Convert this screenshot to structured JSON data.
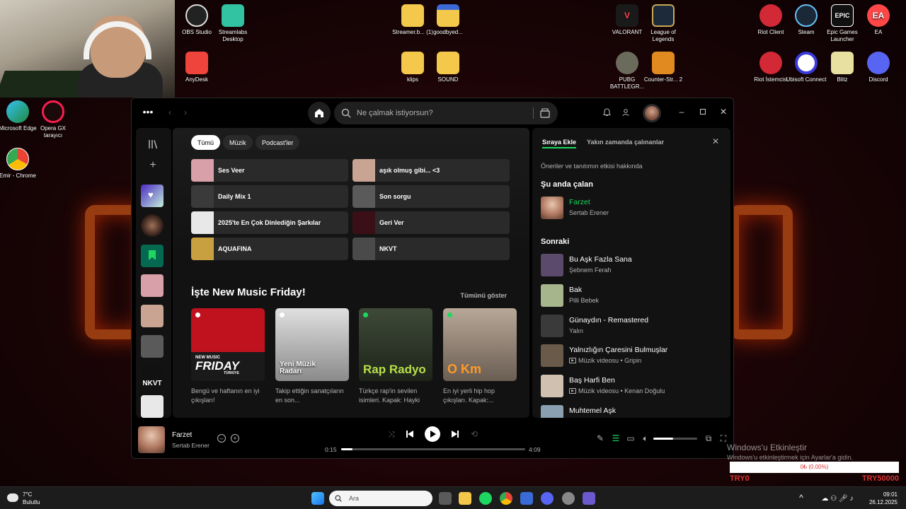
{
  "desktop": {
    "icons": [
      {
        "label": "OBS Studio"
      },
      {
        "label": "Streamlabs Desktop"
      },
      {
        "label": "AnyDesk"
      },
      {
        "label": "Streamer.b... (1)"
      },
      {
        "label": "goodbyed..."
      },
      {
        "label": "klips"
      },
      {
        "label": "SOUND"
      },
      {
        "label": "VALORANT"
      },
      {
        "label": "League of Legends"
      },
      {
        "label": "PUBG BATTLEGR..."
      },
      {
        "label": "Counter-Str... 2"
      },
      {
        "label": "Riot Client"
      },
      {
        "label": "Steam"
      },
      {
        "label": "Epic Games Launcher"
      },
      {
        "label": "EA"
      },
      {
        "label": "Riot İstemcisi"
      },
      {
        "label": "Ubisoft Connect"
      },
      {
        "label": "Blitz"
      },
      {
        "label": "Discord"
      },
      {
        "label": "Microsoft Edge"
      },
      {
        "label": "Opera GX tarayıcı"
      },
      {
        "label": "Emir - Chrome"
      }
    ],
    "epic_logo_text": "EPIC",
    "ea_logo_text": "EA"
  },
  "spotify": {
    "search_placeholder": "Ne çalmak istiyorsun?",
    "filters": [
      {
        "label": "Tümü",
        "active": true
      },
      {
        "label": "Müzik",
        "active": false
      },
      {
        "label": "Podcast'ler",
        "active": false
      }
    ],
    "quick_picks": [
      {
        "title": "Ses Veer",
        "color": "#d8a0a8"
      },
      {
        "title": "aşık olmuş gibi... <3",
        "color": "#c9a493"
      },
      {
        "title": "Daily Mix 1",
        "color": "#3a3a3a"
      },
      {
        "title": "Son sorgu",
        "color": "#5a5a5a"
      },
      {
        "title": "2025'te En Çok Dinlediğin Şarkılar",
        "color": "#e8e8e8"
      },
      {
        "title": "Geri Ver",
        "color": "#3a1016"
      },
      {
        "title": "AQUAFINA",
        "color": "#c9a040"
      },
      {
        "title": "NKVT",
        "color": "#4a4a4a"
      }
    ],
    "section": {
      "title": "İşte New Music Friday!",
      "show_all": "Tümünü göster"
    },
    "albums": [
      {
        "cover_text": "FRIDAY",
        "cover_sub": "NEW MUSIC",
        "cover_tag": "TÜRKİYE",
        "desc": "Bengü ve haftanın en iyi çıkışları!",
        "color": "#c0121e"
      },
      {
        "cover_text": "Yeni Müzik Radarı",
        "desc": "Takip ettiğin sanatçıların en son...",
        "color": "#bcbcbc"
      },
      {
        "cover_text": "Rap Radyo",
        "desc": "Türkçe rap'in sevilen isimleri. Kapak: Hayki",
        "color": "#2f3a2a"
      },
      {
        "cover_text": "O Km",
        "desc": "En iyi yerli hip hop çıkışları. Kapak:...",
        "color": "#8a7d70"
      }
    ],
    "queue": {
      "tabs": [
        {
          "label": "Sıraya Ekle",
          "active": true
        },
        {
          "label": "Yakın zamanda çalınanlar",
          "active": false
        }
      ],
      "info": "Öneriler ve tanıtımın etkisi hakkında",
      "now_playing_heading": "Şu anda çalan",
      "now_playing": {
        "title": "Farzet",
        "artist": "Sertab Erener"
      },
      "next_heading": "Sonraki",
      "next": [
        {
          "title": "Bu Aşk Fazla Sana",
          "artist": "Şebnem Ferah",
          "video": false,
          "color": "#5b4a6b"
        },
        {
          "title": "Bak",
          "artist": "Pilli Bebek",
          "video": false,
          "color": "#a6b58c"
        },
        {
          "title": "Günaydın - Remastered",
          "artist": "Yalın",
          "video": false,
          "color": "#3a3a3a"
        },
        {
          "title": "Yalnızlığın Çaresini Bulmuşlar",
          "artist": "Müzik videosu • Gripin",
          "video": true,
          "color": "#6a5a4a"
        },
        {
          "title": "Baş Harfi Ben",
          "artist": "Müzik videosu • Kenan Doğulu",
          "video": true,
          "color": "#d0c0b0"
        },
        {
          "title": "Muhtemel Aşk",
          "artist": "",
          "video": false,
          "color": "#8aa0b0"
        }
      ]
    },
    "player": {
      "title": "Farzet",
      "artist": "Sertab Erener",
      "elapsed": "0:15",
      "duration": "4:09",
      "progress": 0.06,
      "volume": 0.45
    },
    "sidebar_tile_nkvt": "NKVT"
  },
  "overlay": {
    "activate_title": "Windows'u Etkinleştir",
    "activate_sub": "Windows'u etkinleştirmek için Ayarlar'a gidin.",
    "try_box": "0₺ (0.00%)",
    "try_left": "TRY0",
    "try_right": "TRY50000"
  },
  "taskbar": {
    "weather_temp": "7°C",
    "weather_desc": "Bulutlu",
    "search_label": "Ara",
    "time": "09:01",
    "date": "26.12.2025"
  },
  "colors": {
    "spotify_green": "#1ed760",
    "accent_red": "#dd3333"
  }
}
